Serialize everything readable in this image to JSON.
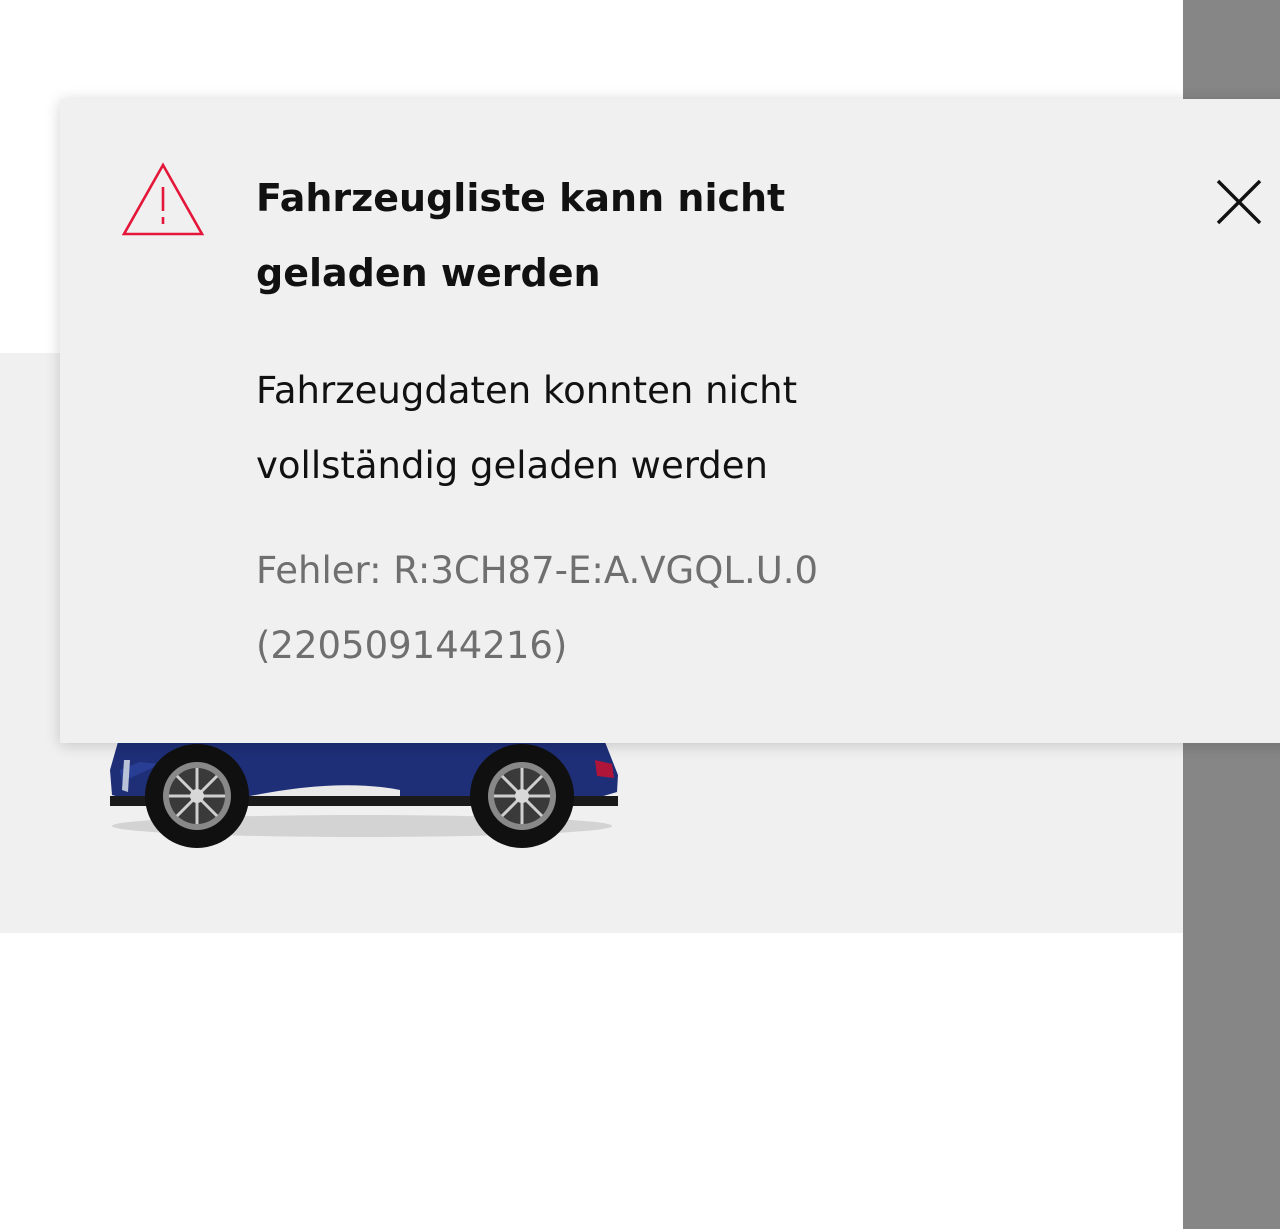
{
  "toast": {
    "title_line1": "Fahrzeugliste kann nicht",
    "title_line2": "geladen werden",
    "message_line1": "Fahrzeugdaten konnten nicht",
    "message_line2": "vollständig geladen werden",
    "error_line1": "Fehler: R:3CH87-E:A.VGQL.U.0",
    "error_line2": "(220509144216)",
    "warning_icon": "warning-triangle-icon",
    "close_icon": "close-icon"
  },
  "colors": {
    "warning_accent": "#e4173a",
    "toast_background": "#f0f0f0",
    "title_text": "#111111",
    "error_text": "#6f6f6f",
    "overlay_scrim": "#868686",
    "vehicle_paint": "#1e2f78"
  }
}
